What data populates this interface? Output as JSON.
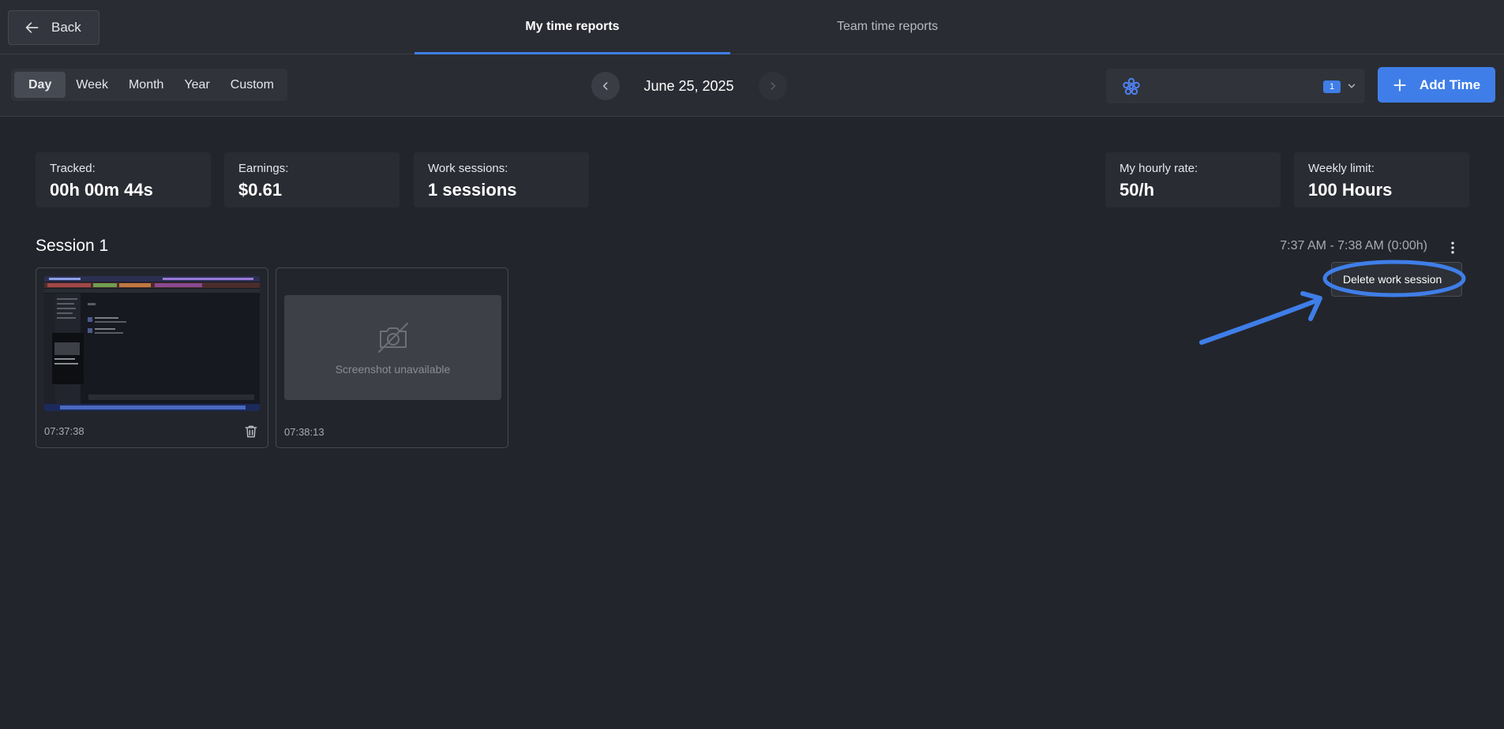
{
  "header": {
    "back_label": "Back",
    "tabs": [
      {
        "label": "My time reports",
        "active": true
      },
      {
        "label": "Team time reports",
        "active": false
      }
    ]
  },
  "toolbar": {
    "ranges": [
      {
        "label": "Day",
        "active": true
      },
      {
        "label": "Week",
        "active": false
      },
      {
        "label": "Month",
        "active": false
      },
      {
        "label": "Year",
        "active": false
      },
      {
        "label": "Custom",
        "active": false
      }
    ],
    "date": "June 25, 2025",
    "team_badge": "1",
    "add_time_label": "Add Time"
  },
  "stats": {
    "tracked": {
      "label": "Tracked:",
      "value": "00h 00m 44s"
    },
    "earnings": {
      "label": "Earnings:",
      "value": "$0.61"
    },
    "sessions": {
      "label": "Work sessions:",
      "value": "1 sessions"
    },
    "hourly_rate": {
      "label": "My hourly rate:",
      "value": "50/h"
    },
    "weekly_limit": {
      "label": "Weekly limit:",
      "value": "100 Hours"
    }
  },
  "session": {
    "title": "Session 1",
    "time_range": "7:37 AM - 7:38 AM (0:00h)",
    "menu": {
      "delete_label": "Delete work session"
    },
    "screenshots": [
      {
        "time": "07:37:38",
        "available": true
      },
      {
        "time": "07:38:13",
        "available": false,
        "unavailable_text": "Screenshot unavailable"
      }
    ]
  },
  "colors": {
    "background": "#23252c",
    "panel": "#2a2c33",
    "accent": "#3f7ee8",
    "annotation": "#3f7ee8"
  },
  "icons": {
    "back": "arrow-left-icon",
    "prev": "chevron-left-icon",
    "next": "chevron-right-icon",
    "team": "flower-logo-icon",
    "select": "chevron-down-icon",
    "add": "plus-icon",
    "menu": "more-vertical-icon",
    "delete": "trash-icon",
    "unavailable": "camera-off-icon"
  }
}
